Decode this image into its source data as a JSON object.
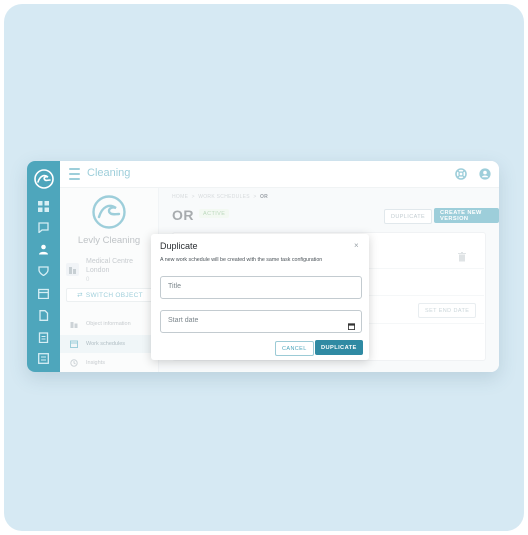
{
  "app": {
    "title": "Cleaning",
    "brand_color": "#4ea6bc"
  },
  "rail": {
    "logo_icon": "wave-logo-icon",
    "items": [
      {
        "icon": "dashboard-icon"
      },
      {
        "icon": "chat-icon"
      },
      {
        "icon": "user-icon"
      },
      {
        "icon": "shield-icon"
      },
      {
        "icon": "calendar-icon"
      },
      {
        "icon": "document-icon"
      },
      {
        "icon": "clipboard-icon"
      },
      {
        "icon": "list-icon"
      }
    ]
  },
  "topbar": {
    "support_icon": "lifebuoy-icon",
    "account_icon": "account-icon"
  },
  "sidebar": {
    "org_name": "Levly Cleaning",
    "site": {
      "name": "Medical Centre",
      "city": "London",
      "number": "0"
    },
    "switch_label": "SWITCH OBJECT",
    "nav": [
      {
        "label": "Object information",
        "icon": "building-icon"
      },
      {
        "label": "Work schedules",
        "icon": "calendar-icon"
      },
      {
        "label": "Insights",
        "icon": "history-icon"
      }
    ]
  },
  "main": {
    "breadcrumb": {
      "home": "HOME",
      "section": "WORK SCHEDULES",
      "current": "OR",
      "separator": ">"
    },
    "title": "OR",
    "status": "ACTIVE",
    "duplicate_label": "DUPLICATE",
    "create_label": "CREATE NEW VERSION",
    "set_end_date_label": "SET END DATE"
  },
  "modal": {
    "title": "Duplicate",
    "close": "×",
    "description": "A new work schedule will be created with the same task configuration",
    "title_placeholder": "Title",
    "start_date_placeholder": "Start date",
    "cancel_label": "CANCEL",
    "confirm_label": "DUPLICATE"
  }
}
